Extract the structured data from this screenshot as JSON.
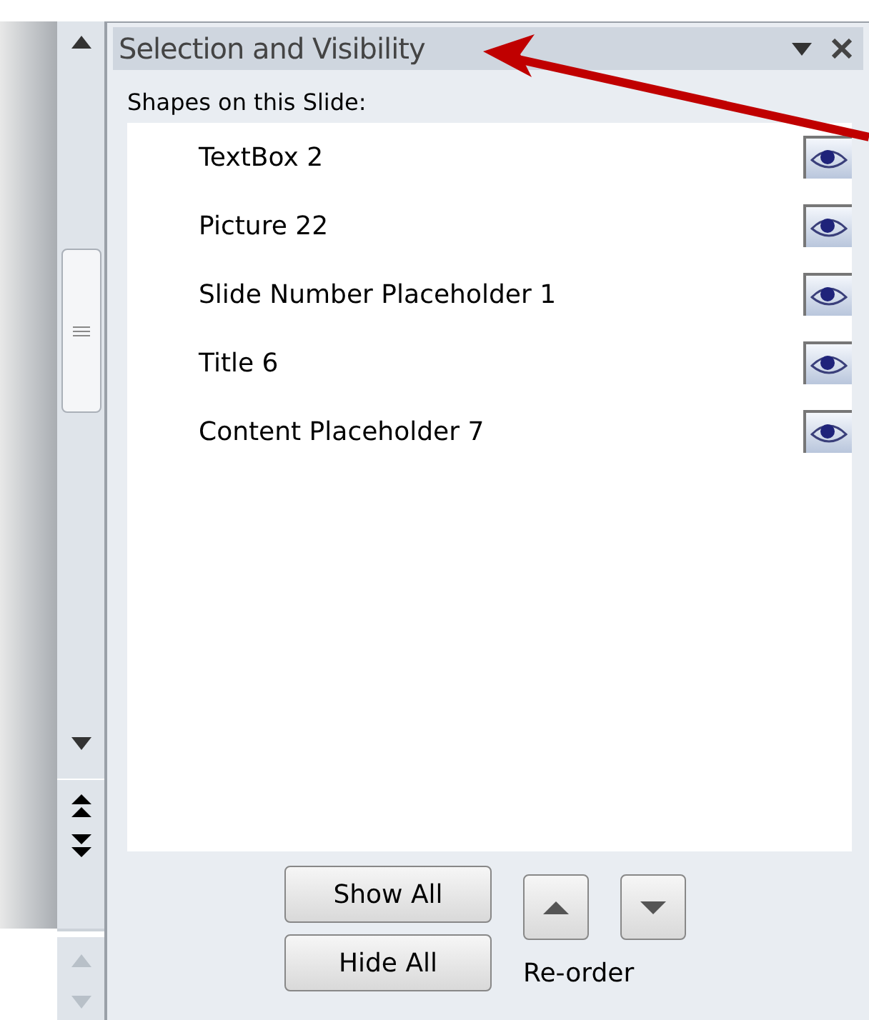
{
  "pane": {
    "title": "Selection and Visibility"
  },
  "list_label": "Shapes on this Slide:",
  "shapes": [
    {
      "name": "TextBox 2",
      "visible": true
    },
    {
      "name": "Picture 22",
      "visible": true
    },
    {
      "name": "Slide Number Placeholder 1",
      "visible": true
    },
    {
      "name": "Title 6",
      "visible": true
    },
    {
      "name": "Content Placeholder 7",
      "visible": true
    }
  ],
  "buttons": {
    "show_all": "Show All",
    "hide_all": "Hide All"
  },
  "reorder_label": "Re-order"
}
